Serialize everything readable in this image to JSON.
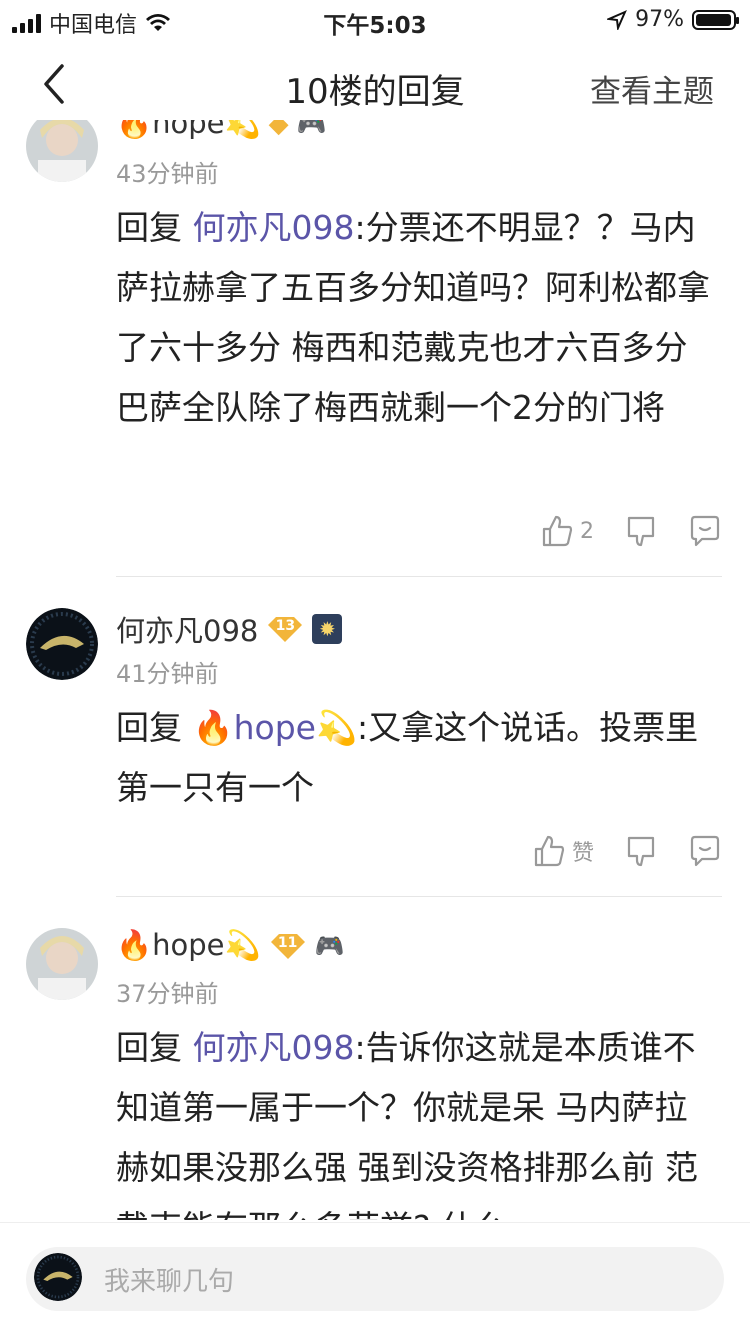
{
  "status_bar": {
    "carrier": "中国电信",
    "time": "下午5:03",
    "battery": "97%",
    "battery_level": 0.97
  },
  "nav": {
    "title": "10楼的回复",
    "right_link": "查看主题"
  },
  "posts": [
    {
      "username": "🔥hope💫",
      "level": "",
      "time": "43分钟前",
      "reply_prefix": "回复 ",
      "mention": "何亦凡098",
      "text": ":分票还不明显？？马内萨拉赫拿了五百多分知道吗？阿利松都拿了六十多分 梅西和范戴克也才六百多分 巴萨全队除了梅西就剩一个2分的门将",
      "like_count": "2"
    },
    {
      "username": "何亦凡098",
      "level": "13",
      "time": "41分钟前",
      "reply_prefix": "回复 ",
      "mention": "🔥hope💫",
      "text": ":又拿这个说话。投票里第一只有一个",
      "like_count": "赞"
    },
    {
      "username": "🔥hope💫",
      "level": "11",
      "time": "37分钟前",
      "reply_prefix": "回复 ",
      "mention": "何亦凡098",
      "text": ":告诉你这就是本质谁不知道第一属于一个？你就是呆 马内萨拉赫如果没那么强 强到没资格排那么前 范戴克能有那么多荣誉? 什么",
      "like_count": ""
    }
  ],
  "bottom": {
    "placeholder": "我来聊几句"
  },
  "colors": {
    "mention": "#5b55a8",
    "meta": "#999999",
    "badge_gold": "#f2b53a"
  }
}
